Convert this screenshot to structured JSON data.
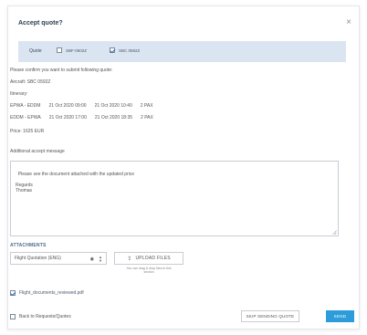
{
  "dialog": {
    "title": "Accept quote?",
    "close_glyph": "×"
  },
  "quote": {
    "label": "Quote",
    "options": [
      {
        "label": "SBF-0502Z",
        "checked": false
      },
      {
        "label": "SBC 0592Z",
        "checked": true
      }
    ]
  },
  "confirm_text": "Please confirm you want to submit following quote:",
  "aircraft": "Aircraft: SBC 0592Z",
  "itinerary_label": "Itinerary:",
  "itinerary": [
    {
      "route": "EPWA - EDDM",
      "dep": "21 Oct 2020 09:00",
      "arr": "21 Oct 2020 10:40",
      "pax": "2 PAX"
    },
    {
      "route": "EDDM - EPWA",
      "dep": "21 Oct 2020 17:00",
      "arr": "21 Oct 2020 18:35",
      "pax": "2 PAX"
    }
  ],
  "price": "Price: 1625 EUR",
  "message_label": "Additional accept message",
  "message": "Please see the document attached with the updated price\n\nRegards\nThomas",
  "attachments": {
    "title": "ATTACHMENTS",
    "select_value": "Flight Quotation (ENG)",
    "upload_label": "UPLOAD FILES",
    "upload_icon": "upload-icon",
    "hint": "You can drag & drop files to this section",
    "file_name": "Flight_documents_reviewed.pdf",
    "file_checked": true
  },
  "footer": {
    "back_label": "Back to Requests/Quotes",
    "back_checked": false,
    "skip_label": "SKIP SENDING QUOTE",
    "send_label": "SEND"
  },
  "colors": {
    "accent": "#2d9cdb",
    "quote_bar": "#dbe5f2",
    "title": "#2e4053"
  }
}
